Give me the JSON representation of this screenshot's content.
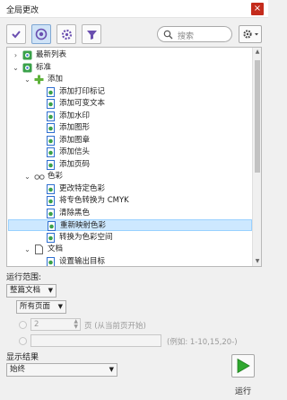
{
  "window": {
    "title": "全局更改",
    "close_glyph": "×"
  },
  "toolbar": {
    "buttons": [
      {
        "name": "checkmark-icon",
        "active": false
      },
      {
        "name": "target-icon",
        "active": true
      },
      {
        "name": "gear-icon",
        "active": false
      },
      {
        "name": "filter-icon",
        "active": false
      }
    ],
    "search_placeholder": "搜索",
    "settings_icon": "gear-dropdown-icon"
  },
  "tree": {
    "rows": [
      {
        "label": "最新列表",
        "depth": 0,
        "expander": "›",
        "icon": "script-icon"
      },
      {
        "label": "标准",
        "depth": 0,
        "expander": "⌄",
        "icon": "script-icon"
      },
      {
        "label": "添加",
        "depth": 1,
        "expander": "⌄",
        "icon": "plus-icon"
      },
      {
        "label": "添加打印标记",
        "depth": 2,
        "expander": "",
        "icon": "doc-icon"
      },
      {
        "label": "添加可变文本",
        "depth": 2,
        "expander": "",
        "icon": "doc-icon"
      },
      {
        "label": "添加水印",
        "depth": 2,
        "expander": "",
        "icon": "doc-icon"
      },
      {
        "label": "添加图形",
        "depth": 2,
        "expander": "",
        "icon": "doc-icon"
      },
      {
        "label": "添加图章",
        "depth": 2,
        "expander": "",
        "icon": "doc-icon"
      },
      {
        "label": "添加信头",
        "depth": 2,
        "expander": "",
        "icon": "doc-icon"
      },
      {
        "label": "添加页码",
        "depth": 2,
        "expander": "",
        "icon": "doc-icon"
      },
      {
        "label": "色彩",
        "depth": 1,
        "expander": "⌄",
        "icon": "glasses-icon"
      },
      {
        "label": "更改特定色彩",
        "depth": 2,
        "expander": "",
        "icon": "doc-icon"
      },
      {
        "label": "将专色转换为 CMYK",
        "depth": 2,
        "expander": "",
        "icon": "doc-icon"
      },
      {
        "label": "清除黑色",
        "depth": 2,
        "expander": "",
        "icon": "doc-icon"
      },
      {
        "label": "重新映射色彩",
        "depth": 2,
        "expander": "",
        "icon": "doc-icon",
        "selected": true
      },
      {
        "label": "转换为色彩空间",
        "depth": 2,
        "expander": "",
        "icon": "doc-icon"
      },
      {
        "label": "文档",
        "depth": 1,
        "expander": "⌄",
        "icon": "page-icon"
      },
      {
        "label": "设置输出目标",
        "depth": 2,
        "expander": "",
        "icon": "doc-icon"
      }
    ]
  },
  "run_scope": {
    "label": "运行范围:",
    "document_select": "整篇文档",
    "pages_select": "所有页面",
    "start_page_value": "2",
    "start_page_suffix": "页 (从当前页开始)",
    "range_value": "",
    "range_hint": "(例如: 1-10,15,20-)"
  },
  "show_result": {
    "label": "显示结果",
    "select": "始终"
  },
  "run": {
    "label": "运行",
    "icon": "play-icon",
    "color": "#2fa82f"
  }
}
